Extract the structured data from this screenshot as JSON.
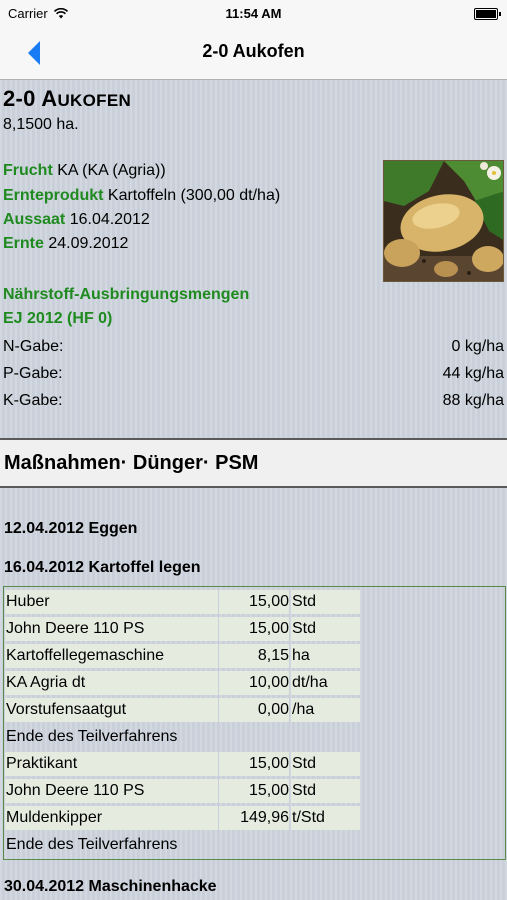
{
  "status_bar": {
    "carrier": "Carrier",
    "time": "11:54 AM"
  },
  "nav": {
    "title": "2-0 Aukofen"
  },
  "field": {
    "title_prefix": "2-0 A",
    "title_rest": "UKOFEN",
    "area": "8,1500 ha."
  },
  "info": {
    "frucht_label": "Frucht",
    "frucht_value": " KA (KA (Agria))",
    "ernteprodukt_label": "Ernteprodukt",
    "ernteprodukt_value": " Kartoffeln (300,00 dt/ha)",
    "aussaat_label": "Aussaat",
    "aussaat_value": " 16.04.2012",
    "ernte_label": "Ernte",
    "ernte_value": " 24.09.2012"
  },
  "nutrients": {
    "heading": "Nährstoff-Ausbringungsmengen",
    "subheading": "EJ 2012 (HF 0)",
    "rows": [
      {
        "label": "N-Gabe:",
        "value": "0 kg/ha"
      },
      {
        "label": "P-Gabe:",
        "value": "44 kg/ha"
      },
      {
        "label": "K-Gabe:",
        "value": "88 kg/ha"
      }
    ]
  },
  "section": {
    "title": "Maßnahmen· Dünger· PSM"
  },
  "events": [
    {
      "title": "12.04.2012 Eggen"
    },
    {
      "title": "16.04.2012 Kartoffel legen"
    },
    {
      "title": "30.04.2012 Maschinenhacke"
    }
  ],
  "operations": [
    {
      "name": "Huber",
      "amount": "15,00",
      "unit": "Std"
    },
    {
      "name": "John Deere 110 PS",
      "amount": "15,00",
      "unit": "Std"
    },
    {
      "name": "Kartoffellegemaschine",
      "amount": "8,15",
      "unit": "ha"
    },
    {
      "name": "KA Agria dt",
      "amount": "10,00",
      "unit": "dt/ha"
    },
    {
      "name": "Vorstufensaatgut",
      "amount": "0,00",
      "unit": "/ha"
    },
    {
      "name": "Ende des Teilverfahrens"
    },
    {
      "name": "Praktikant",
      "amount": "15,00",
      "unit": "Std"
    },
    {
      "name": "John Deere 110 PS",
      "amount": "15,00",
      "unit": "Std"
    },
    {
      "name": "Muldenkipper",
      "amount": "149,96",
      "unit": "t/Std"
    },
    {
      "name": "Ende des Teilverfahrens"
    }
  ],
  "colors": {
    "accent_blue": "#1a7cf5",
    "label_green": "#1f8a1f"
  },
  "icons": {
    "back": "chevron-left-icon",
    "wifi": "wifi-icon",
    "battery": "battery-icon",
    "photo": "potato-image"
  }
}
